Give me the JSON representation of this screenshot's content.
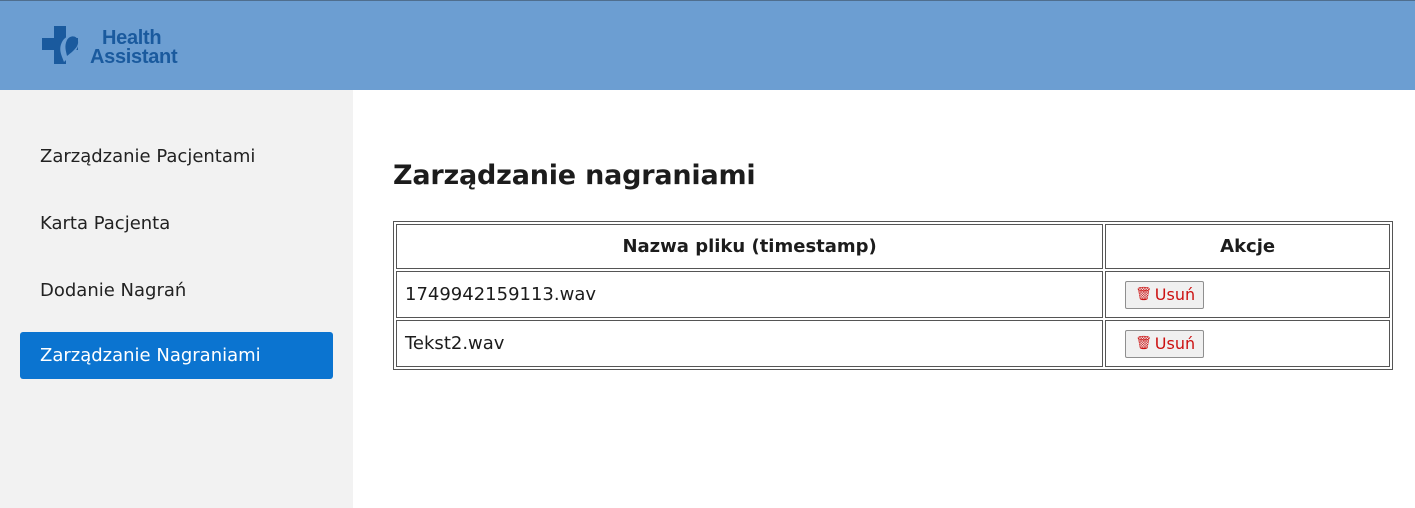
{
  "header": {
    "logo_line1": "Health",
    "logo_line2": "Assistant",
    "brand_color": "#1a5a9e",
    "bar_color": "#6c9ed2",
    "logo_icon": "medical-cross-heart-icon"
  },
  "sidebar": {
    "items": [
      {
        "label": "Zarządzanie Pacjentami",
        "active": false
      },
      {
        "label": "Karta Pacjenta",
        "active": false
      },
      {
        "label": "Dodanie Nagrań",
        "active": false
      },
      {
        "label": "Zarządzanie Nagraniami",
        "active": true
      }
    ],
    "active_color": "#0b74d0"
  },
  "main": {
    "title": "Zarządzanie nagraniami",
    "table": {
      "headers": [
        "Nazwa pliku (timestamp)",
        "Akcje"
      ],
      "rows": [
        {
          "filename": "1749942159113.wav",
          "action_label": "Usuń",
          "action_icon": "trash-icon"
        },
        {
          "filename": "Tekst2.wav",
          "action_label": "Usuń",
          "action_icon": "trash-icon"
        }
      ]
    },
    "delete_color": "#cc1111"
  }
}
